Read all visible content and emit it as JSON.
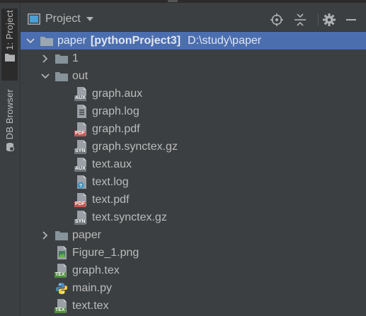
{
  "colors": {
    "background": "#3c3f41",
    "selection": "#4b6eaf",
    "text": "#bbbbbb",
    "folder": "#87939a",
    "pdf_badge": "#c75450",
    "tex_badge": "#4e8c3d"
  },
  "left_stripe": {
    "project_tab": "1: Project",
    "db_browser_tab": "DB Browser"
  },
  "header": {
    "view_title": "Project",
    "icons": [
      "locate-icon",
      "collapse-all-icon",
      "gear-icon",
      "hide-icon"
    ]
  },
  "tree": [
    {
      "name": "paper",
      "module": "[pythonProject3]",
      "path": "D:\\study\\paper",
      "type": "folder",
      "expanded": true,
      "selected": true
    },
    {
      "name": "1",
      "type": "folder",
      "expanded": false
    },
    {
      "name": "out",
      "type": "folder",
      "expanded": true
    },
    {
      "name": "graph.aux",
      "type": "aux",
      "badge": "AUX"
    },
    {
      "name": "graph.log",
      "type": "log"
    },
    {
      "name": "graph.pdf",
      "type": "pdf",
      "badge": "PDF"
    },
    {
      "name": "graph.synctex.gz",
      "type": "syn",
      "badge": "SYN"
    },
    {
      "name": "text.aux",
      "type": "aux",
      "badge": "AUX"
    },
    {
      "name": "text.log",
      "type": "unknown"
    },
    {
      "name": "text.pdf",
      "type": "pdf",
      "badge": "PDF"
    },
    {
      "name": "text.synctex.gz",
      "type": "syn",
      "badge": "SYN"
    },
    {
      "name": "paper",
      "type": "folder",
      "expanded": false
    },
    {
      "name": "Figure_1.png",
      "type": "image"
    },
    {
      "name": "graph.tex",
      "type": "tex",
      "badge": "TEX"
    },
    {
      "name": "main.py",
      "type": "python"
    },
    {
      "name": "text.tex",
      "type": "tex",
      "badge": "TEX"
    }
  ]
}
